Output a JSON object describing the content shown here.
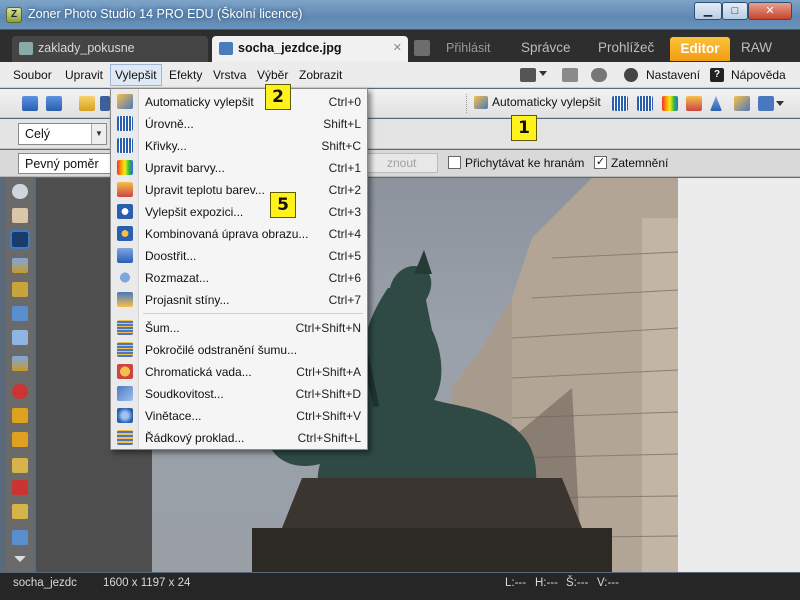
{
  "window": {
    "title": "Zoner Photo Studio 14 PRO EDU (Školní licence)",
    "app_icon_letter": "Z",
    "min_glyph": "▁",
    "max_glyph": "□",
    "close_glyph": "✕"
  },
  "tabs": {
    "documents": [
      {
        "label": "zaklady_pokusne",
        "active": false
      },
      {
        "label": "socha_jezdce.jpg",
        "active": true,
        "close_glyph": "✕"
      }
    ],
    "login": "Přihlásit",
    "modules": [
      "Správce",
      "Prohlížeč",
      "Editor",
      "RAW"
    ],
    "active_module": "Editor"
  },
  "menubar": {
    "items": [
      "Soubor",
      "Upravit",
      "Vylepšit",
      "Efekty",
      "Vrstva",
      "Výběr",
      "Zobrazit"
    ],
    "open_item": "Vylepšit",
    "settings": "Nastavení",
    "help": "Nápověda",
    "help_glyph": "?"
  },
  "toolbar": {
    "auto_enhance": "Automaticky vylepšit",
    "scope_value": "Celý",
    "ratio_value": "Pevný poměr",
    "disabled_button_text": "znout",
    "snap_label": "Přichytávat ke hranám",
    "snap_checked": false,
    "darken_label": "Zatemnění",
    "darken_checked": true,
    "check_glyph": "✓"
  },
  "enhance_menu": {
    "items": [
      {
        "label": "Automaticky vylepšit",
        "shortcut": "Ctrl+0",
        "icon": "auto-enhance-icon"
      },
      {
        "label": "Úrovně...",
        "shortcut": "Shift+L",
        "icon": "levels-icon"
      },
      {
        "label": "Křivky...",
        "shortcut": "Shift+C",
        "icon": "curves-icon"
      },
      {
        "label": "Upravit barvy...",
        "shortcut": "Ctrl+1",
        "icon": "rainbow-colors-icon"
      },
      {
        "label": "Upravit teplotu barev...",
        "shortcut": "Ctrl+2",
        "icon": "temperature-icon"
      },
      {
        "label": "Vylepšit expozici...",
        "shortcut": "Ctrl+3",
        "icon": "exposure-icon"
      },
      {
        "label": "Kombinovaná úprava obrazu...",
        "shortcut": "Ctrl+4",
        "icon": "combined-adjust-icon"
      },
      {
        "label": "Doostřit...",
        "shortcut": "Ctrl+5",
        "icon": "sharpen-icon"
      },
      {
        "label": "Rozmazat...",
        "shortcut": "Ctrl+6",
        "icon": "blur-drop-icon"
      },
      {
        "label": "Projasnit stíny...",
        "shortcut": "Ctrl+7",
        "icon": "shadows-icon"
      },
      {
        "label": "Šum...",
        "shortcut": "Ctrl+Shift+N",
        "icon": "noise-icon"
      },
      {
        "label": "Pokročilé odstranění šumu...",
        "shortcut": "",
        "icon": "advanced-noise-icon"
      },
      {
        "label": "Chromatická vada...",
        "shortcut": "Ctrl+Shift+A",
        "icon": "chromatic-star-icon"
      },
      {
        "label": "Soudkovitost...",
        "shortcut": "Ctrl+Shift+D",
        "icon": "barrel-distortion-icon"
      },
      {
        "label": "Vinětace...",
        "shortcut": "Ctrl+Shift+V",
        "icon": "vignette-icon"
      },
      {
        "label": "Řádkový proklad...",
        "shortcut": "Ctrl+Shift+L",
        "icon": "interlace-icon"
      }
    ]
  },
  "annotations": {
    "badge1": "1",
    "badge2": "2",
    "badge5": "5"
  },
  "statusbar": {
    "filename": "socha_jezdc",
    "dimensions": "1600 x 1197 x 24",
    "l": "L:---",
    "h": "H:---",
    "s": "Š:---",
    "v": "V:---"
  },
  "colors": {
    "accent": "#f5a623",
    "selection": "#3f79c9",
    "annotation": "#fff21b"
  }
}
